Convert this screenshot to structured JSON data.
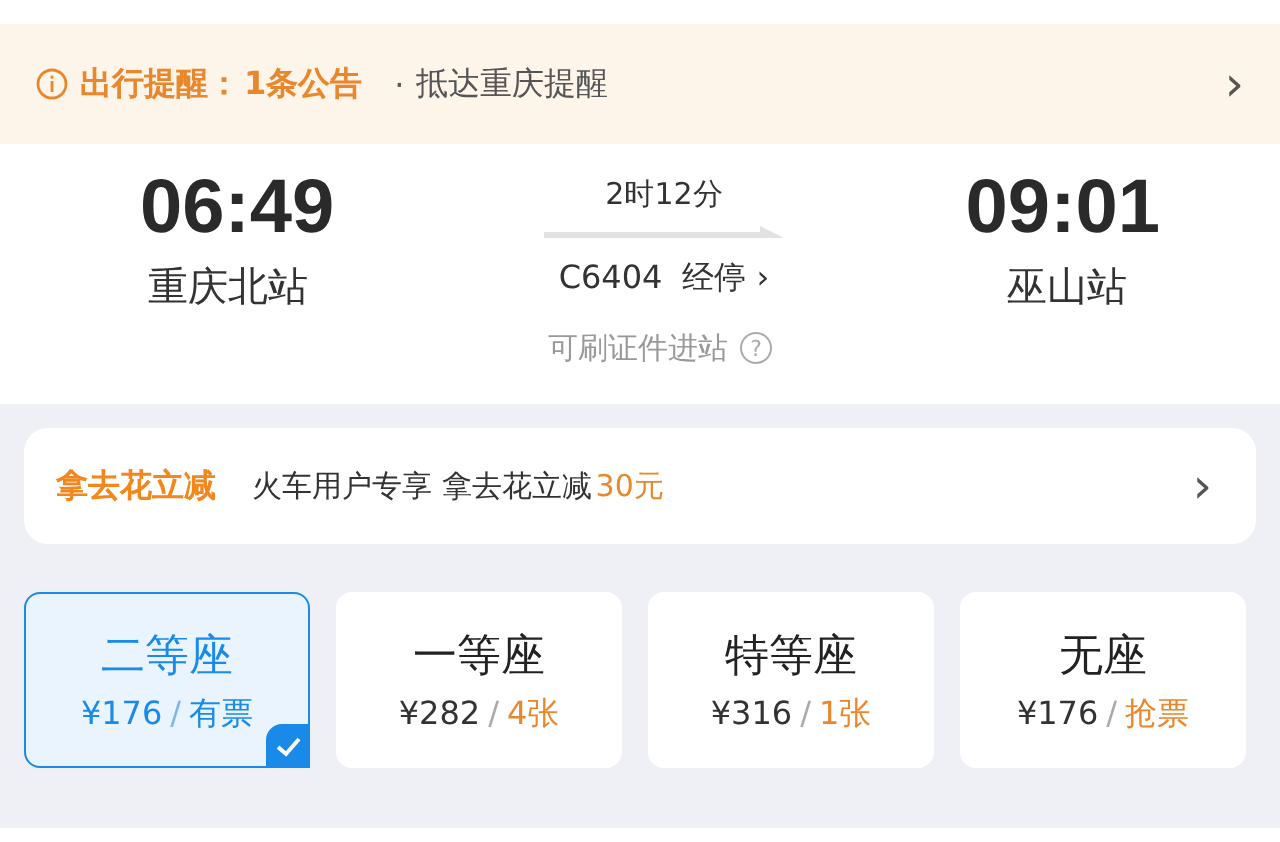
{
  "notice": {
    "title": "出行提醒：",
    "count": "1条公告",
    "bullet": "·",
    "item": "抵达重庆提醒",
    "chevron": "›"
  },
  "trip": {
    "depart_time": "06:49",
    "depart_station": "重庆北站",
    "duration": "2时12分",
    "train": "C6404",
    "stops": "经停",
    "stops_chevron": "›",
    "arrive_time": "09:01",
    "arrive_station": "巫山站",
    "id_note": "可刷证件进站",
    "help": "?"
  },
  "promo": {
    "title": "拿去花立减",
    "text": "火车用户专享 拿去花立减",
    "amount": "30元",
    "chevron": "›"
  },
  "seats": [
    {
      "name": "二等座",
      "price": "¥176",
      "separator": "/",
      "availability": "有票",
      "selected": true
    },
    {
      "name": "一等座",
      "price": "¥282",
      "separator": "/",
      "availability": "4张",
      "selected": false
    },
    {
      "name": "特等座",
      "price": "¥316",
      "separator": "/",
      "availability": "1张",
      "selected": false
    },
    {
      "name": "无座",
      "price": "¥176",
      "separator": "/",
      "availability": "抢票",
      "selected": false
    }
  ]
}
